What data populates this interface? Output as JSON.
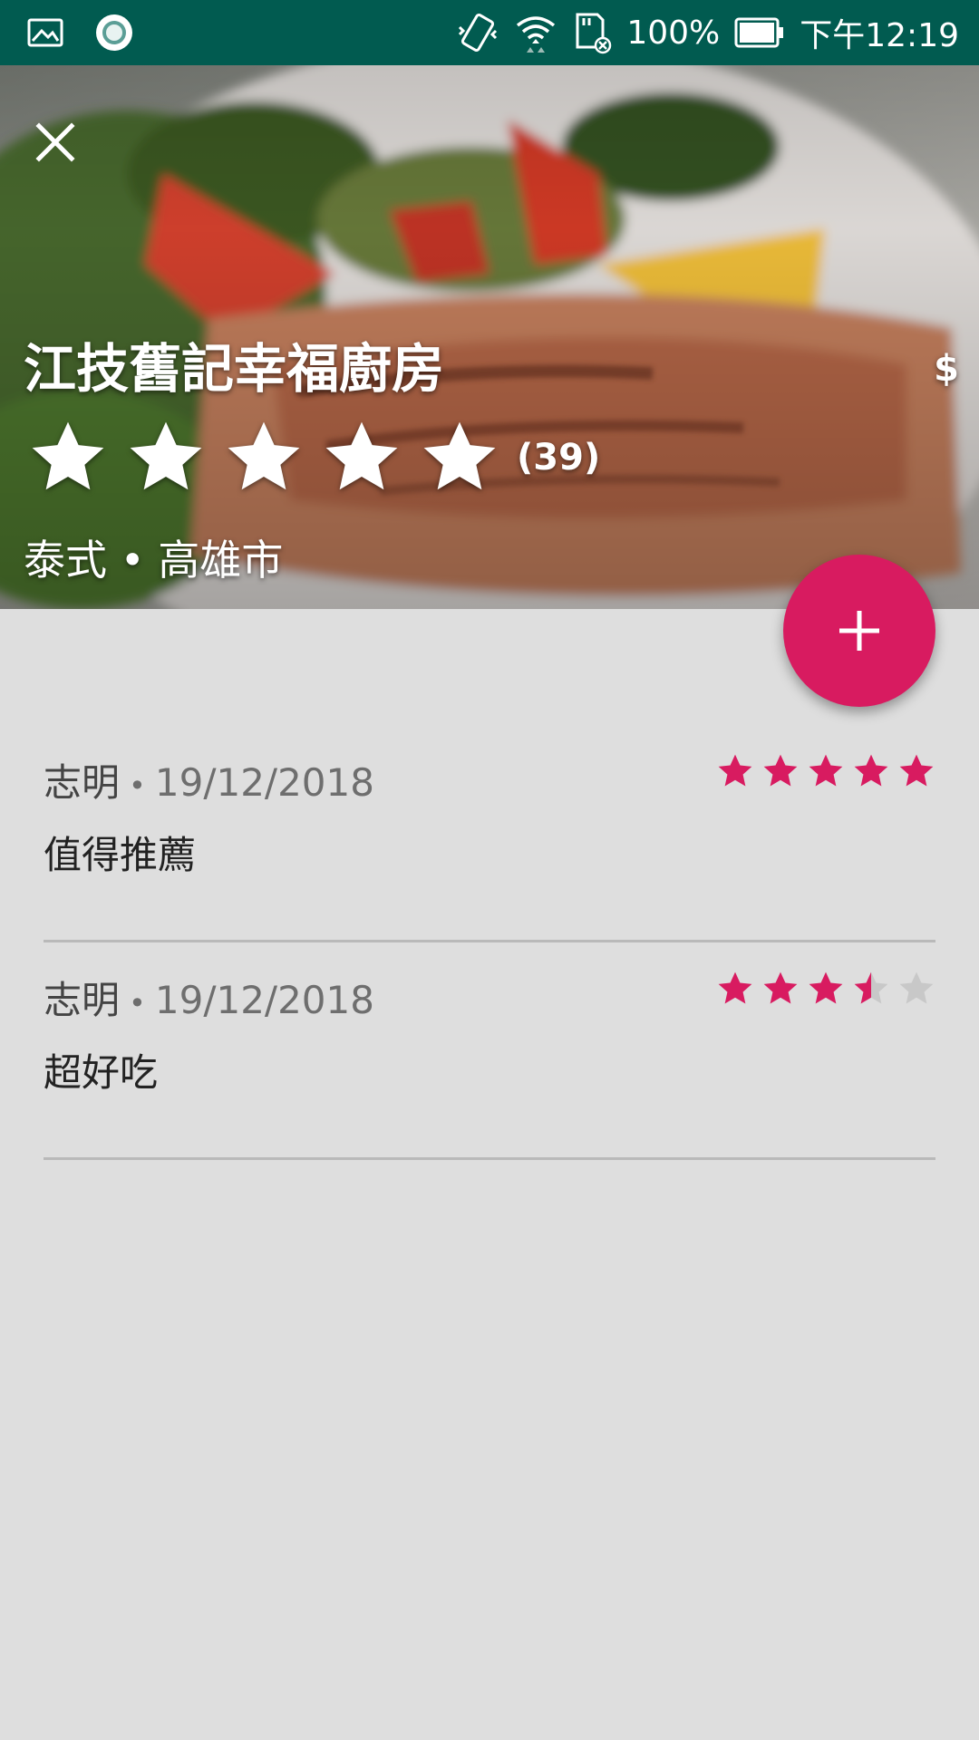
{
  "status_bar": {
    "battery": "100%",
    "time": "下午12:19",
    "icons": [
      "image-icon",
      "circle-notification-icon",
      "vibrate-icon",
      "wifi-icon",
      "sd-card-icon",
      "battery-icon"
    ]
  },
  "restaurant": {
    "name": "江技舊記幸福廚房",
    "price": "$",
    "rating": 5,
    "rating_max": 5,
    "review_count": "(39)",
    "category_city": "泰式 • 高雄市",
    "hero_image": "salmon-salad-photo"
  },
  "actions": {
    "close_icon": "close-icon",
    "add_icon": "plus-icon"
  },
  "colors": {
    "status_bar": "#015b50",
    "accent": "#d81b60",
    "background": "#dedede",
    "star_empty": "#c8c8c8"
  },
  "reviews": [
    {
      "author": "志明",
      "separator": "•",
      "date": "19/12/2018",
      "text": "值得推薦",
      "rating": 5
    },
    {
      "author": "志明",
      "separator": "•",
      "date": "19/12/2018",
      "text": "超好吃",
      "rating": 3.5
    }
  ]
}
